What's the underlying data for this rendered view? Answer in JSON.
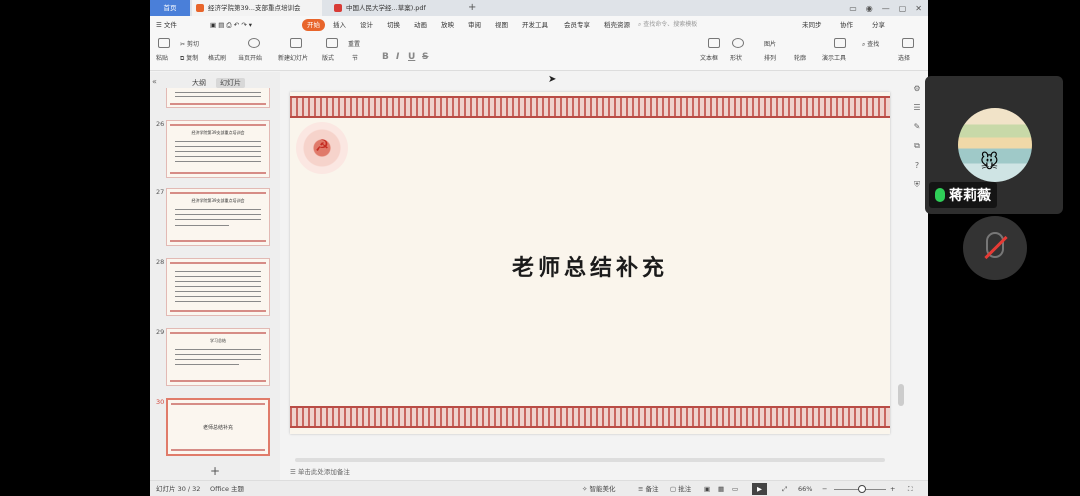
{
  "tabs": {
    "home": "首页",
    "doc": "经济学院第39...支部重点培训会",
    "pdf": "中国人民大学经...草案).pdf"
  },
  "menu": [
    "文件",
    "开始",
    "插入",
    "设计",
    "切换",
    "动画",
    "放映",
    "审阅",
    "视图",
    "开发工具",
    "会员专享",
    "稻壳资源"
  ],
  "menu_active": "开始",
  "search_placeholder": "查找命令、搜索模板",
  "menu_right": [
    "未同步",
    "协作",
    "分享"
  ],
  "ribbon": {
    "paste": "粘贴",
    "cut": "剪切",
    "copy": "复制",
    "format_painter": "格式刷",
    "from_current": "当页开始",
    "new_slide": "新建幻灯片",
    "layout": "版式",
    "section": "节",
    "reset": "重置",
    "textbox": "文本框",
    "shape": "形状",
    "arrange": "排列",
    "picture": "图片",
    "outline": "轮廓",
    "presentation_tools": "演示工具",
    "find": "查找",
    "select": "选择"
  },
  "left_panel": {
    "tab_outline": "大纲",
    "tab_slides": "幻灯片",
    "slides": [
      {
        "num": "26",
        "title": "经济学院第39支部重点培训会"
      },
      {
        "num": "27",
        "title": "经济学院第39支部重点培训会"
      },
      {
        "num": "28",
        "title": ""
      },
      {
        "num": "29",
        "title": "学习总结"
      },
      {
        "num": "30",
        "title": "老师总结补充"
      }
    ],
    "add_icon": "plus-icon"
  },
  "slide": {
    "title": "老师总结补充",
    "emblem": "party-emblem-icon",
    "colors": {
      "border": "#c9665f",
      "background": "#faf5ec"
    }
  },
  "notes_placeholder": "单击此处添加备注",
  "status": {
    "slide_count": "幻灯片 30 / 32",
    "theme": "Office 主题",
    "smart_beautify": "智能美化",
    "notes": "备注",
    "comments": "批注",
    "zoom": "66%"
  },
  "meeting": {
    "participant_name": "蒋莉薇",
    "mic_color": "#2fcf58",
    "mute_icon": "mic-muted-icon"
  }
}
